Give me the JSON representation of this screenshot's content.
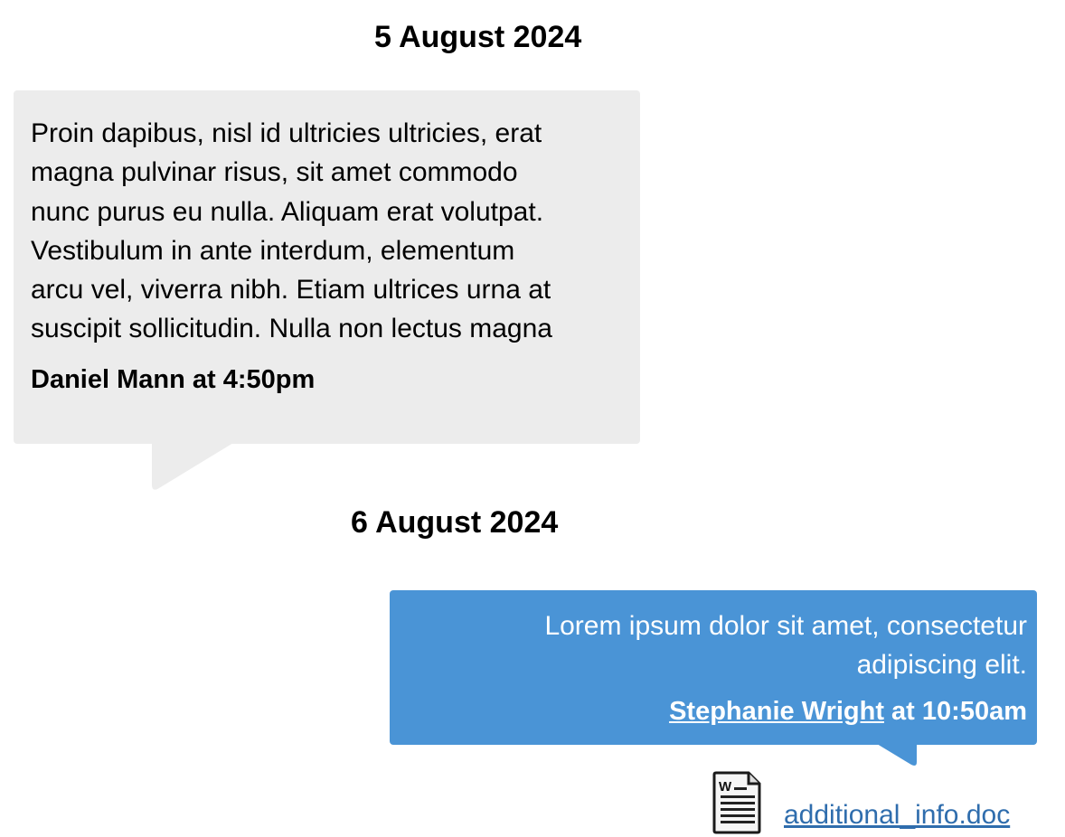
{
  "conversation": {
    "groups": [
      {
        "date": "5 August 2024",
        "messages": [
          {
            "direction": "incoming",
            "text": "Proin dapibus, nisl id ultricies ultricies, erat\nmagna pulvinar risus, sit amet commodo\nnunc purus eu nulla. Aliquam erat volutpat.\nVestibulum in ante interdum, elementum\narcu vel, viverra nibh. Etiam ultrices urna at\nsuscipit sollicitudin. Nulla non lectus magna",
            "meta": "Daniel Mann at 4:50pm",
            "bubble_color": "#ececec"
          }
        ]
      },
      {
        "date": "6 August 2024",
        "messages": [
          {
            "direction": "outgoing",
            "text": "Lorem ipsum dolor sit amet, consectetur\nadipiscing elit.",
            "author": "Stephanie Wright",
            "time_suffix": " at 10:50am",
            "bubble_color": "#4a94d6",
            "attachment": {
              "icon": "word-document-icon",
              "filename": "additional_info.doc",
              "link_color": "#2f6dad"
            }
          }
        ]
      }
    ]
  }
}
